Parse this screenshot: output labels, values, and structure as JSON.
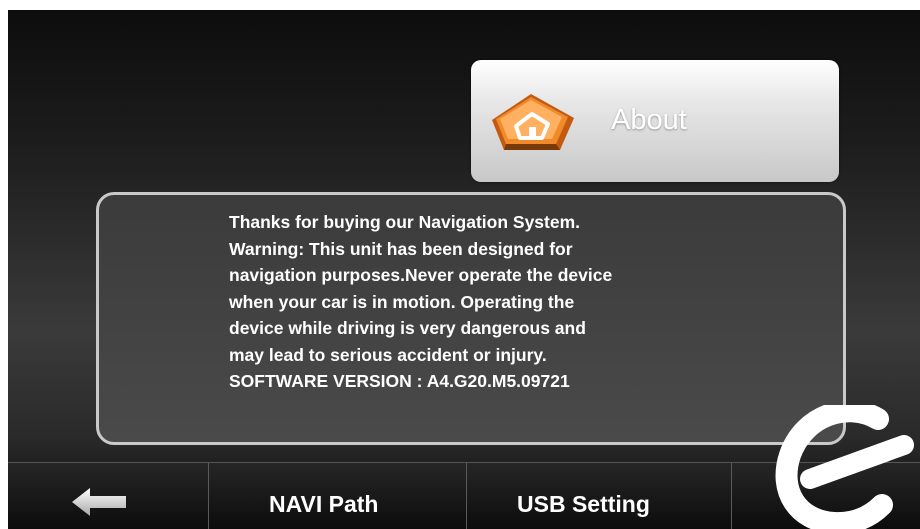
{
  "header": {
    "tab_label": "About",
    "icon": "home-book-icon"
  },
  "info": {
    "lines": [
      "Thanks for buying our Navigation System.",
      "Warning: This unit has been designed for",
      "navigation purposes.Never operate the device",
      "when your car is in motion. Operating the",
      "device  while driving is very dangerous and",
      "may lead to serious accident or injury.",
      "SOFTWARE VERSION : A4.G20.M5.09721"
    ]
  },
  "bottom_bar": {
    "back_icon": "back-arrow-icon",
    "navi_path_label": "NAVI Path",
    "usb_setting_label": "USB Setting"
  },
  "colors": {
    "text": "#ffffff",
    "tab_background": "#e0e0e0",
    "icon_orange": "#e8731a",
    "panel_border": "#c9c9c9"
  }
}
